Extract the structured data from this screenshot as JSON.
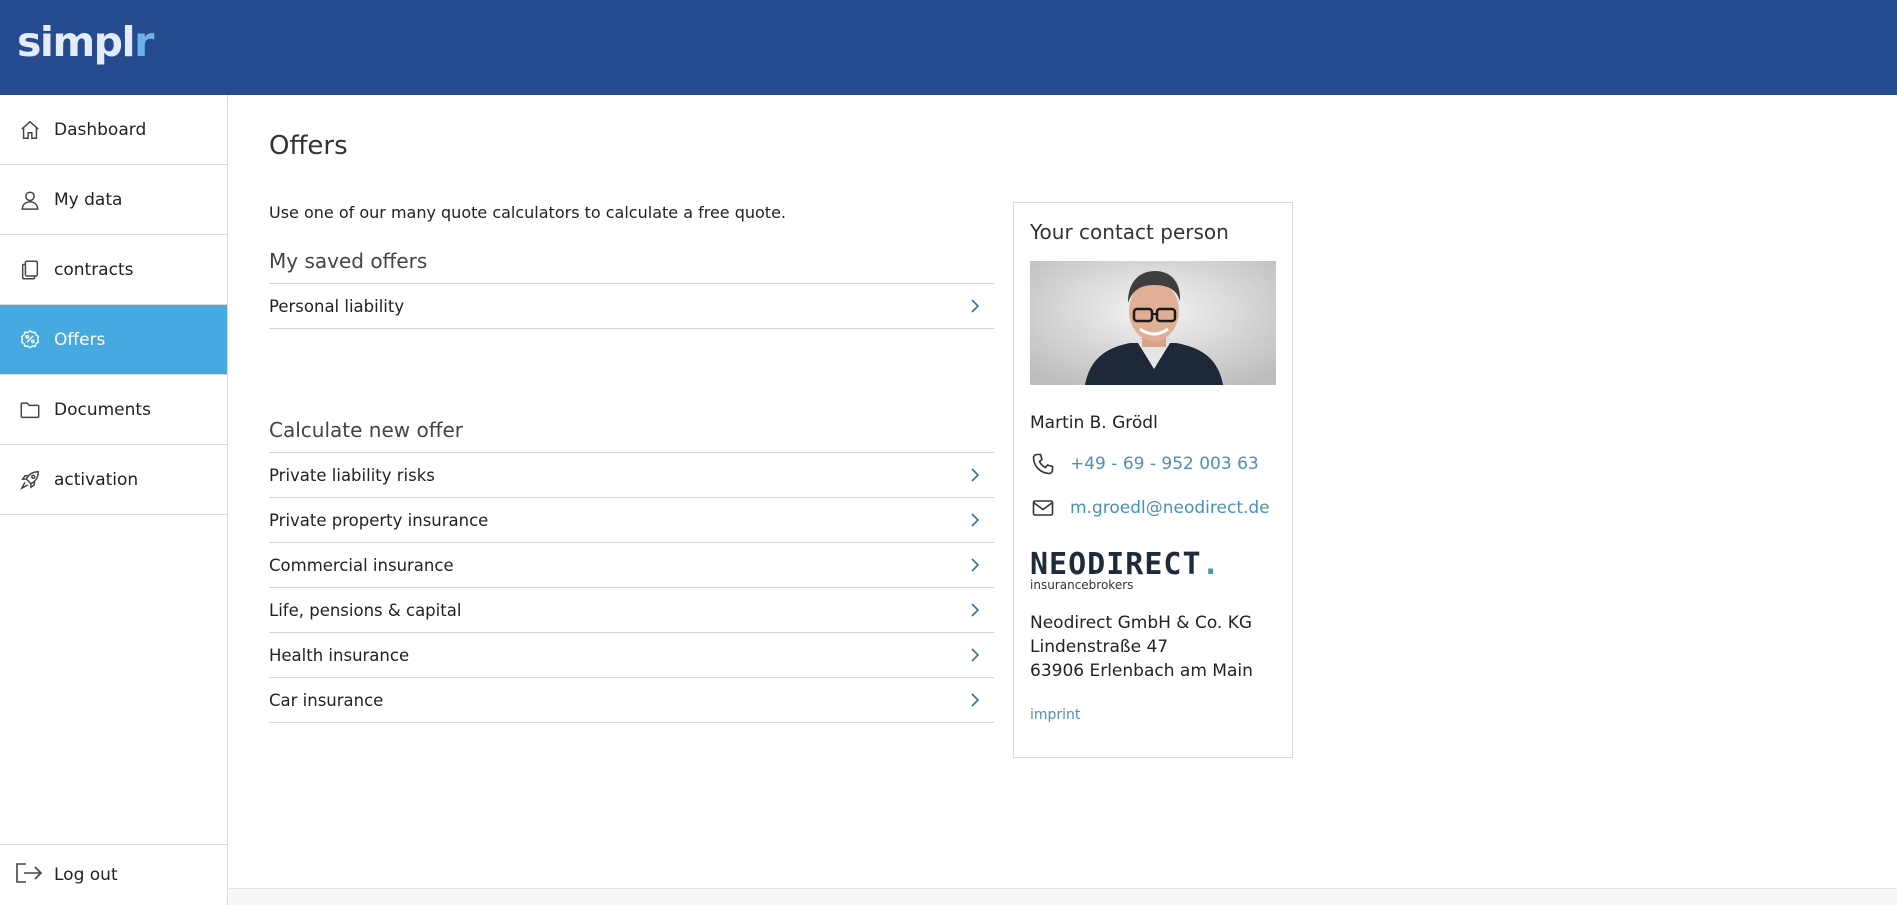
{
  "header": {
    "logo_main": "simpl",
    "logo_accent": "r"
  },
  "sidebar": {
    "items": [
      {
        "label": "Dashboard",
        "icon": "home-icon"
      },
      {
        "label": "My data",
        "icon": "user-icon"
      },
      {
        "label": "contracts",
        "icon": "documents-icon"
      },
      {
        "label": "Offers",
        "icon": "percent-badge-icon",
        "active": true
      },
      {
        "label": "Documents",
        "icon": "folder-icon"
      },
      {
        "label": "activation",
        "icon": "rocket-icon"
      }
    ],
    "logout_label": "Log out"
  },
  "main": {
    "title": "Offers",
    "intro": "Use one of our many quote calculators to calculate a free quote.",
    "saved": {
      "title": "My saved offers",
      "items": [
        "Personal liability"
      ]
    },
    "calculate": {
      "title": "Calculate new offer",
      "items": [
        "Private liability risks",
        "Private property insurance",
        "Commercial insurance",
        "Life, pensions & capital",
        "Health insurance",
        "Car insurance"
      ]
    }
  },
  "contact": {
    "title": "Your contact person",
    "name": "Martin B. Grödl",
    "phone": "+49 - 69 - 952 003 63",
    "email": "m.groedl@neodirect.de",
    "brand_name_a": "NEODIRECT",
    "brand_name_b": ".",
    "brand_sub": "insurancebrokers",
    "address": [
      "Neodirect GmbH & Co. KG",
      "Lindenstraße 47",
      "63906 Erlenbach am Main"
    ],
    "imprint": "imprint"
  },
  "colors": {
    "topbar": "#264a8e",
    "active_nav": "#46a9df",
    "link": "#4a90b8",
    "brand_teal": "#4a9aa3"
  }
}
